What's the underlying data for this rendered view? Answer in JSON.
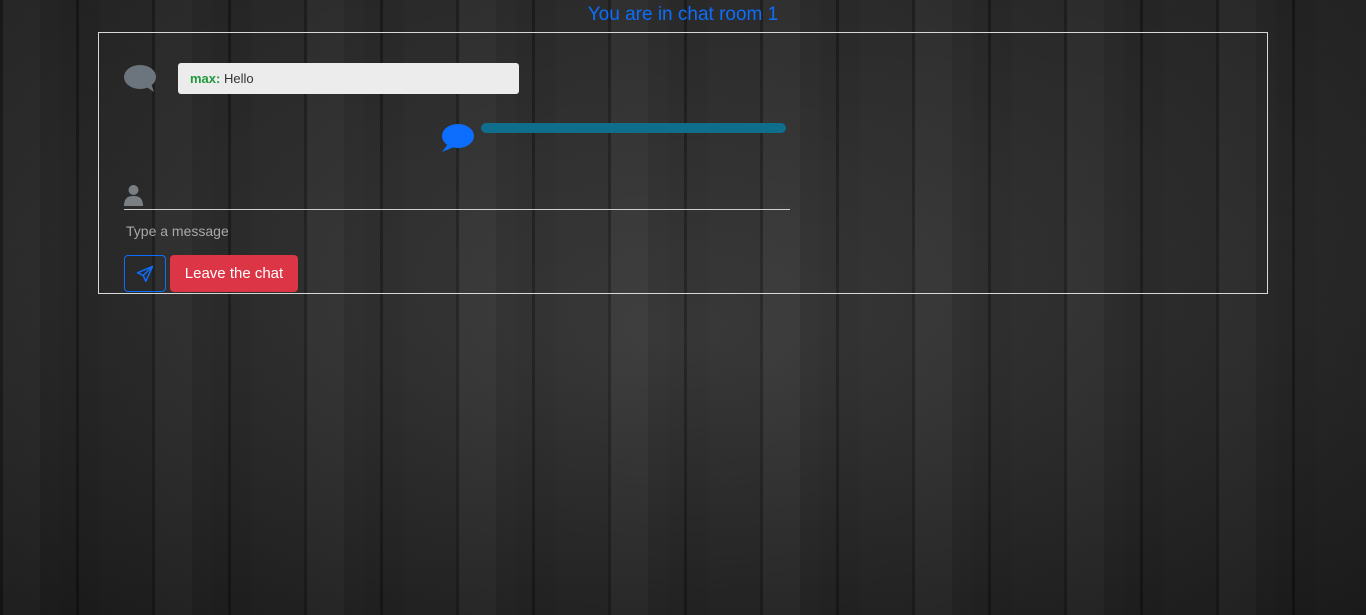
{
  "header": {
    "title": "You are in chat room 1",
    "title_color": "#0d6efd"
  },
  "messages": [
    {
      "icon": "chat-bubble-icon",
      "sender": "max:",
      "text": "Hello",
      "sender_color": "#1f9a3c"
    }
  ],
  "typing_indicator": {
    "icon": "chat-bubble-icon",
    "icon_color": "#0d6efd",
    "bar_color": "#0e6e8c"
  },
  "composer": {
    "user_icon": "user-icon",
    "placeholder": "Type a message",
    "send_icon": "send-icon",
    "leave_label": "Leave the chat",
    "leave_color": "#dc3545"
  }
}
